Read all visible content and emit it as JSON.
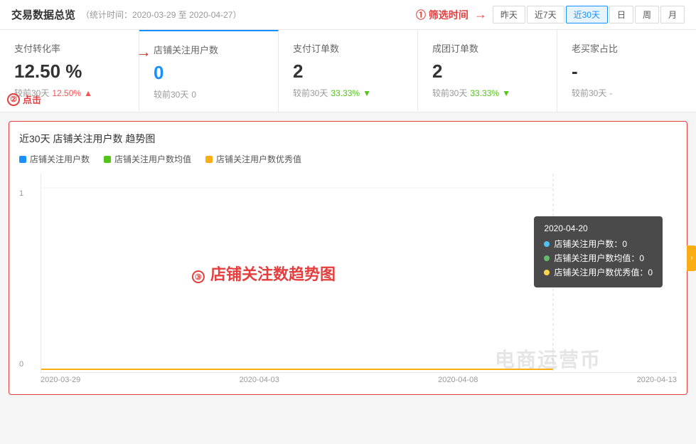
{
  "header": {
    "title": "交易数据总览",
    "subtitle": "（统计时间：2020-03-29 至 2020-04-27）",
    "annotation1": "① 筛选时间"
  },
  "timeFilter": {
    "buttons": [
      "昨天",
      "近7天",
      "近30天",
      "日",
      "周",
      "月"
    ],
    "active": "近30天"
  },
  "metrics": [
    {
      "label": "支付转化率",
      "value": "12.50 %",
      "compare": "较前30天",
      "compareVal": "12.50%",
      "trend": "up",
      "active": false,
      "annotation": "② 点击"
    },
    {
      "label": "店铺关注用户数",
      "value": "0",
      "compare": "较前30天",
      "compareVal": "0",
      "trend": "none",
      "active": true
    },
    {
      "label": "支付订单数",
      "value": "2",
      "compare": "较前30天",
      "compareVal": "33.33%",
      "trend": "down"
    },
    {
      "label": "成团订单数",
      "value": "2",
      "compare": "较前30天",
      "compareVal": "33.33%",
      "trend": "down"
    },
    {
      "label": "老买家占比",
      "value": "-",
      "compare": "较前30天",
      "compareVal": "-",
      "trend": "none"
    }
  ],
  "chart": {
    "title": "近30天 店铺关注用户数 趋势图",
    "legend": [
      {
        "color": "blue",
        "label": "店铺关注用户数"
      },
      {
        "color": "green",
        "label": "店铺关注用户数均值"
      },
      {
        "color": "yellow",
        "label": "店铺关注用户数优秀值"
      }
    ],
    "annotation3": "③ 店铺关注数趋势图",
    "yLabels": [
      "1",
      "0"
    ],
    "xLabels": [
      "2020-03-29",
      "2020-04-03",
      "2020-04-08",
      "2020-04-13"
    ],
    "tooltip": {
      "date": "2020-04-20",
      "rows": [
        {
          "color": "blue",
          "label": "店铺关注用户数：",
          "value": "0"
        },
        {
          "color": "green",
          "label": "店铺关注用户数均值：",
          "value": "0"
        },
        {
          "color": "yellow",
          "label": "店铺关注用户数优秀值：",
          "value": "0"
        }
      ]
    }
  },
  "watermark": "电商运营币"
}
